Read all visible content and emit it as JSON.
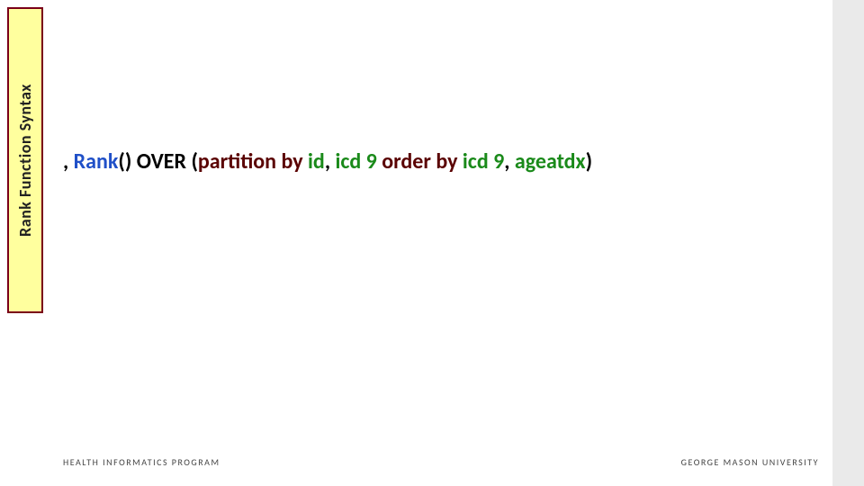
{
  "sidebar": {
    "title": "Rank Function Syntax"
  },
  "code": {
    "comma": ", ",
    "rank": "Rank",
    "paren1": "() ",
    "over": "OVER ",
    "paren2": "(",
    "partition_by": "partition by ",
    "id": "id",
    "sep1": ", ",
    "icd9a": "icd 9 ",
    "order_by": "order by ",
    "icd9b": "icd 9",
    "sep2": ", ",
    "ageatdx": "ageatdx",
    "paren3": ")"
  },
  "footer": {
    "left": "HEALTH INFORMATICS PROGRAM",
    "right": "GEORGE MASON UNIVERSITY"
  }
}
